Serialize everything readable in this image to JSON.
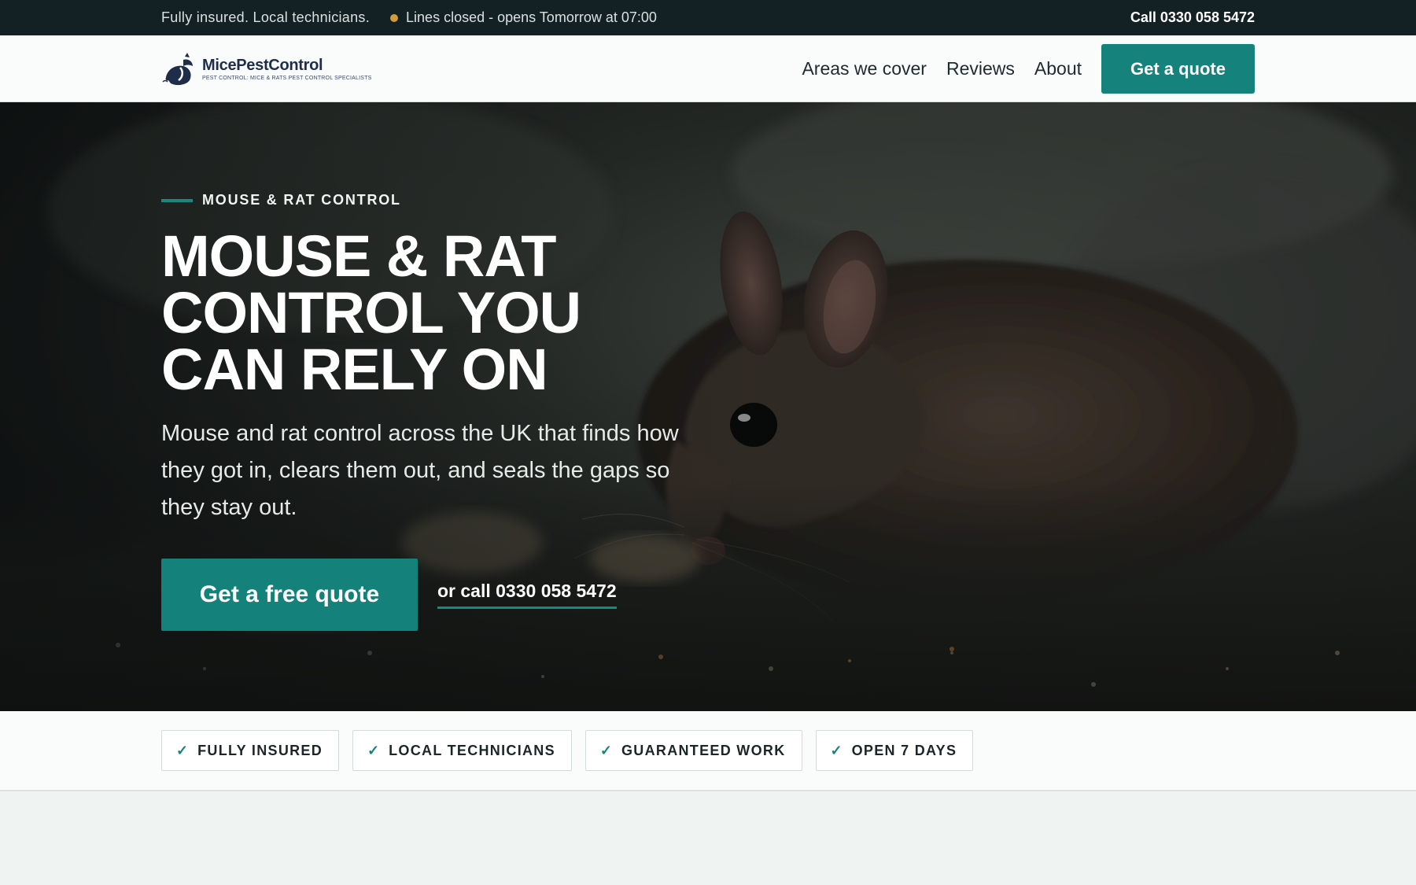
{
  "topbar": {
    "message": "Fully insured. Local technicians.",
    "status": "Lines closed - opens Tomorrow at 07:00",
    "call": "Call 0330 058 5472"
  },
  "header": {
    "logo": {
      "name_part1": "Mice",
      "name_part2": "PestControl",
      "tagline": "PEST CONTROL: MICE & RATS PEST CONTROL SPECIALISTS"
    },
    "nav": {
      "items": [
        {
          "label": "Areas we cover"
        },
        {
          "label": "Reviews"
        },
        {
          "label": "About"
        }
      ],
      "quote_label": "Get a quote"
    }
  },
  "hero": {
    "eyebrow": "MOUSE & RAT CONTROL",
    "title_lines": [
      "MOUSE & RAT",
      "CONTROL YOU",
      "CAN RELY ON"
    ],
    "lede": "Mouse and rat control across the UK that finds how they got in, clears them out, and seals the gaps so they stay out.",
    "primary_cta": "Get a free quote",
    "call_cta": "or call 0330 058 5472",
    "image": "mouse-photo"
  },
  "trust": {
    "badges": [
      {
        "label": "FULLY INSURED",
        "icon": "check-icon"
      },
      {
        "label": "LOCAL TECHNICIANS",
        "icon": "check-icon"
      },
      {
        "label": "GUARANTEED WORK",
        "icon": "check-icon"
      },
      {
        "label": "OPEN 7 DAYS",
        "icon": "check-icon"
      }
    ]
  },
  "colors": {
    "brand_teal": "#15837b",
    "topbar_bg": "#142124",
    "status_dot": "#d39b3c",
    "page_bg": "#eff3f2"
  }
}
